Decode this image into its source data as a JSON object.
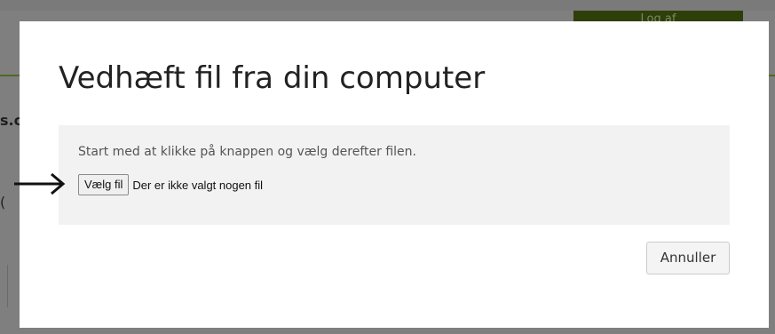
{
  "background": {
    "header_button_label": "Log af",
    "fragment_bold": "s.c",
    "fragment_paren": "("
  },
  "modal": {
    "title": "Vedhæft fil fra din computer",
    "instruction": "Start med at klikke på knappen og vælg derefter filen.",
    "file_input": {
      "button_label": "Vælg fil",
      "status": "Der er ikke valgt nogen fil"
    },
    "cancel_label": "Annuller"
  },
  "annotation": {
    "icon": "arrow-right-icon",
    "color": "#111111"
  },
  "colors": {
    "overlay": "#7f7f7f",
    "header_button": "#2e3f0a",
    "accent_green": "#4f6a22",
    "panel_bg": "#f2f2f2"
  }
}
